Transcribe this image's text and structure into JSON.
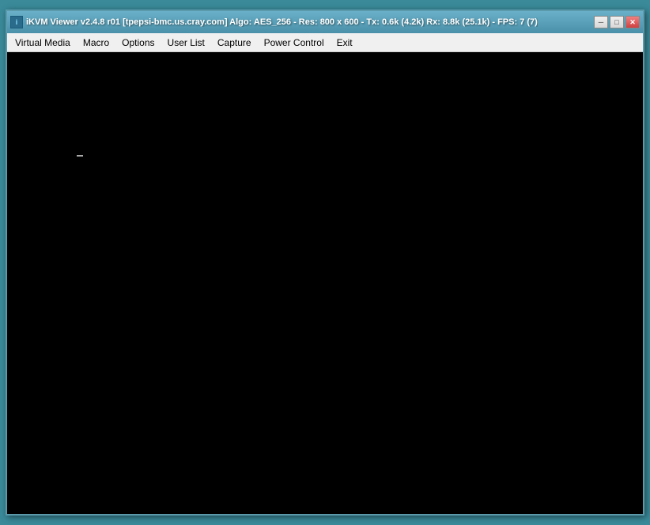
{
  "window": {
    "title": "iKVM Viewer v2.4.8 r01 [tpepsi-bmc.us.cray.com] Algo: AES_256 - Res: 800 x 600 - Tx: 0.6k (4.2k) Rx: 8.8k (25.1k) - FPS: 7 (7)"
  },
  "titlebar": {
    "icon_label": "i",
    "minimize_label": "─",
    "maximize_label": "□",
    "close_label": "✕"
  },
  "menu": {
    "items": [
      {
        "label": "Virtual Media"
      },
      {
        "label": "Macro"
      },
      {
        "label": "Options"
      },
      {
        "label": "User List"
      },
      {
        "label": "Capture"
      },
      {
        "label": "Power Control"
      },
      {
        "label": "Exit"
      }
    ]
  }
}
